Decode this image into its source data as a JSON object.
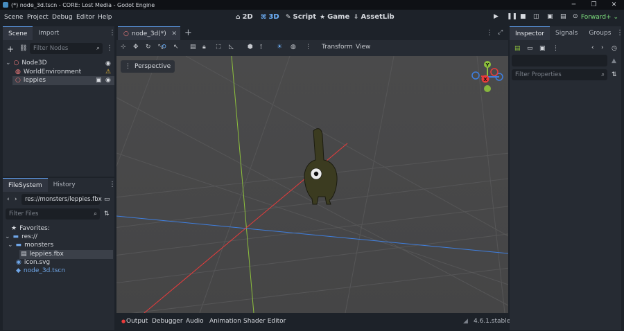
{
  "window": {
    "title": "(*) node_3d.tscn - CORE: Lost Media - Godot Engine",
    "controls": [
      "─",
      "❐",
      "✕"
    ]
  },
  "menubar": {
    "items": [
      "Scene",
      "Project",
      "Debug",
      "Editor",
      "Help"
    ],
    "main_screens": [
      {
        "icon": "⌂",
        "label": "2D"
      },
      {
        "icon": "⌘",
        "label": "3D"
      },
      {
        "icon": "✎",
        "label": "Script"
      },
      {
        "icon": "★",
        "label": "Game"
      },
      {
        "icon": "⇩",
        "label": "AssetLib"
      }
    ],
    "renderer": "Forward+ ⌄"
  },
  "scene_dock": {
    "tabs": [
      "Scene",
      "Import"
    ],
    "filter_placeholder": "Filter Nodes",
    "tree": [
      {
        "label": "Node3D",
        "icon_color": "#fc7f7f",
        "depth": 0
      },
      {
        "label": "WorldEnvironment",
        "icon_color": "#fc7f7f",
        "depth": 1
      },
      {
        "label": "leppies",
        "icon_color": "#fc7f7f",
        "depth": 1
      }
    ]
  },
  "filesystem_dock": {
    "tabs": [
      "FileSystem",
      "History"
    ],
    "path": "res://monsters/leppies.fbx",
    "filter_placeholder": "Filter Files",
    "tree": [
      {
        "label": "Favorites:",
        "icon": "★",
        "depth": 0
      },
      {
        "label": "res://",
        "icon": "▬",
        "depth": 0
      },
      {
        "label": "monsters",
        "icon": "▬",
        "depth": 1
      },
      {
        "label": "leppies.fbx",
        "icon": "▤",
        "depth": 2
      },
      {
        "label": "icon.svg",
        "icon": "◉",
        "depth": 1
      },
      {
        "label": "node_3d.tscn",
        "icon": "◆",
        "depth": 1
      }
    ]
  },
  "editor": {
    "tab_label": "node_3d(*)",
    "toolbar_menus": [
      "Transform",
      "View"
    ],
    "perspective_label": "Perspective",
    "gizmo_labels": {
      "y": "Y",
      "x": "X"
    },
    "bottom_tabs": [
      "Output",
      "Debugger",
      "Audio",
      "Animation",
      "Shader Editor"
    ],
    "version": "4.6.1.stable"
  },
  "inspector": {
    "tabs": [
      "Inspector",
      "Signals",
      "Groups"
    ],
    "filter_placeholder": "Filter Properties"
  },
  "colors": {
    "accent": "#70b4ff",
    "x_axis": "#ea3b3b",
    "y_axis": "#8ec23c",
    "z_axis": "#3f7fe0",
    "renderer": "#7ee17e"
  }
}
